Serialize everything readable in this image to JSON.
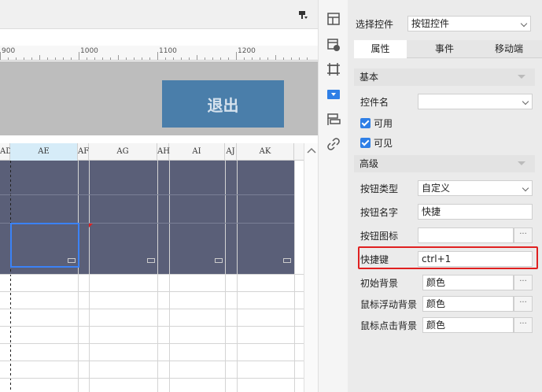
{
  "ruler": {
    "labels": [
      "900",
      "1000",
      "1100",
      "1200"
    ]
  },
  "canvas": {
    "exit_button_label": "退出"
  },
  "grid": {
    "columns": [
      "AD",
      "AE",
      "AF",
      "AG",
      "AH",
      "AI",
      "AJ",
      "AK"
    ]
  },
  "panel": {
    "select_control_label": "选择控件",
    "select_control_value": "按钮控件",
    "tabs": [
      "属性",
      "事件",
      "移动端"
    ],
    "sections": {
      "basic": "基本",
      "advanced": "高级"
    },
    "control_name_label": "控件名",
    "control_name_value": "",
    "enabled_label": "可用",
    "visible_label": "可见",
    "button_type_label": "按钮类型",
    "button_type_value": "自定义",
    "button_name_label": "按钮名字",
    "button_name_value": "快捷",
    "button_icon_label": "按钮图标",
    "button_icon_value": "",
    "hotkey_label": "快捷键",
    "hotkey_value": "ctrl+1",
    "initial_bg_label": "初始背景",
    "initial_bg_value": "颜色",
    "hover_bg_label": "鼠标浮动背景",
    "hover_bg_value": "颜色",
    "click_bg_label": "鼠标点击背景",
    "click_bg_value": "颜色",
    "dots": "···"
  },
  "colors": {
    "accent": "#2f7fe6",
    "exit_button": "#4a7eaa",
    "highlight": "#e02020",
    "cell_fill": "#5a5f78"
  },
  "icons": [
    "layout-icon",
    "widget-settings-icon",
    "frame-icon",
    "control-property-icon",
    "element-list-icon",
    "hyperlink-icon"
  ]
}
